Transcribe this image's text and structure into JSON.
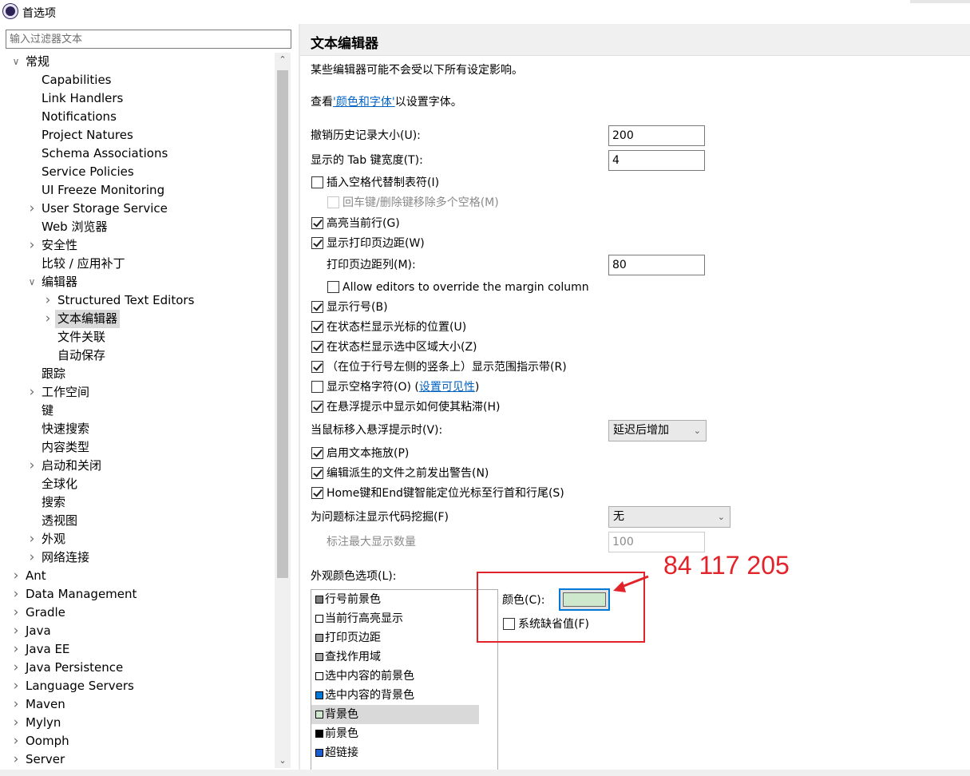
{
  "window": {
    "title": "首选项"
  },
  "filter": {
    "placeholder": "输入过滤器文本"
  },
  "tree": [
    {
      "label": "常规",
      "level": 0,
      "chevron": "expanded"
    },
    {
      "label": "Capabilities",
      "level": 1,
      "chevron": "none"
    },
    {
      "label": "Link Handlers",
      "level": 1,
      "chevron": "none"
    },
    {
      "label": "Notifications",
      "level": 1,
      "chevron": "none"
    },
    {
      "label": "Project Natures",
      "level": 1,
      "chevron": "none"
    },
    {
      "label": "Schema Associations",
      "level": 1,
      "chevron": "none"
    },
    {
      "label": "Service Policies",
      "level": 1,
      "chevron": "none"
    },
    {
      "label": "UI Freeze Monitoring",
      "level": 1,
      "chevron": "none"
    },
    {
      "label": "User Storage Service",
      "level": 1,
      "chevron": "collapsed"
    },
    {
      "label": "Web 浏览器",
      "level": 1,
      "chevron": "none"
    },
    {
      "label": "安全性",
      "level": 1,
      "chevron": "collapsed"
    },
    {
      "label": "比较 / 应用补丁",
      "level": 1,
      "chevron": "none"
    },
    {
      "label": "编辑器",
      "level": 1,
      "chevron": "expanded"
    },
    {
      "label": "Structured Text Editors",
      "level": 2,
      "chevron": "collapsed"
    },
    {
      "label": "文本编辑器",
      "level": 2,
      "chevron": "collapsed",
      "selected": true
    },
    {
      "label": "文件关联",
      "level": 2,
      "chevron": "none"
    },
    {
      "label": "自动保存",
      "level": 2,
      "chevron": "none"
    },
    {
      "label": "跟踪",
      "level": 1,
      "chevron": "none"
    },
    {
      "label": "工作空间",
      "level": 1,
      "chevron": "collapsed"
    },
    {
      "label": "键",
      "level": 1,
      "chevron": "none"
    },
    {
      "label": "快速搜索",
      "level": 1,
      "chevron": "none"
    },
    {
      "label": "内容类型",
      "level": 1,
      "chevron": "none"
    },
    {
      "label": "启动和关闭",
      "level": 1,
      "chevron": "collapsed"
    },
    {
      "label": "全球化",
      "level": 1,
      "chevron": "none"
    },
    {
      "label": "搜索",
      "level": 1,
      "chevron": "none"
    },
    {
      "label": "透视图",
      "level": 1,
      "chevron": "none"
    },
    {
      "label": "外观",
      "level": 1,
      "chevron": "collapsed"
    },
    {
      "label": "网络连接",
      "level": 1,
      "chevron": "collapsed"
    },
    {
      "label": "Ant",
      "level": 0,
      "chevron": "collapsed"
    },
    {
      "label": "Data Management",
      "level": 0,
      "chevron": "collapsed"
    },
    {
      "label": "Gradle",
      "level": 0,
      "chevron": "collapsed"
    },
    {
      "label": "Java",
      "level": 0,
      "chevron": "collapsed"
    },
    {
      "label": "Java EE",
      "level": 0,
      "chevron": "collapsed"
    },
    {
      "label": "Java Persistence",
      "level": 0,
      "chevron": "collapsed"
    },
    {
      "label": "Language Servers",
      "level": 0,
      "chevron": "collapsed"
    },
    {
      "label": "Maven",
      "level": 0,
      "chevron": "collapsed"
    },
    {
      "label": "Mylyn",
      "level": 0,
      "chevron": "collapsed"
    },
    {
      "label": "Oomph",
      "level": 0,
      "chevron": "collapsed"
    },
    {
      "label": "Server",
      "level": 0,
      "chevron": "collapsed"
    }
  ],
  "page": {
    "title": "文本编辑器",
    "note": "某些编辑器可能不会受以下所有设定影响。",
    "font_link_prefix": "查看",
    "font_link": "'颜色和字体'",
    "font_link_suffix": "以设置字体。",
    "undo_label": "撤销历史记录大小(U):",
    "undo_value": "200",
    "tab_label": "显示的 Tab 键宽度(T):",
    "tab_value": "4",
    "insert_spaces": "插入空格代替制表符(I)",
    "backspace_spaces": "回车键/删除键移除多个空格(M)",
    "highlight_line": "高亮当前行(G)",
    "show_margin": "显示打印页边距(W)",
    "margin_col_label": "打印页边距列(M):",
    "margin_col_value": "80",
    "allow_override": "Allow editors to override the margin column",
    "show_line_numbers": "显示行号(B)",
    "status_cursor": "在状态栏显示光标的位置(U)",
    "status_selection": "在状态栏显示选中区域大小(Z)",
    "range_indicator": "（在位于行号左侧的竖条上）显示范围指示带(R)",
    "show_whitespace": "显示空格字符(O) (",
    "whitespace_link": "设置可见性",
    "whitespace_suffix": ")",
    "sticky_hover": "在悬浮提示中显示如何使其粘滞(H)",
    "hover_label": "当鼠标移入悬浮提示时(V):",
    "hover_value": "延迟后增加",
    "drag_drop": "启用文本拖放(P)",
    "warn_derived": "编辑派生的文件之前发出警告(N)",
    "smart_home_end": "Home键和End键智能定位光标至行首和行尾(S)",
    "code_mining_label": "为问题标注显示代码挖掘(F)",
    "code_mining_value": "无",
    "max_annot_label": "标注最大显示数量",
    "max_annot_value": "100",
    "appearance_label": "外观颜色选项(L):",
    "color_label": "颜色(C):",
    "system_default": "系统缺省值(F)",
    "selected_color": "#cde8cc"
  },
  "color_items": [
    {
      "label": "行号前景色",
      "swatch": "#7f7f7f"
    },
    {
      "label": "当前行高亮显示",
      "swatch": "#ffffff"
    },
    {
      "label": "打印页边距",
      "swatch": "#a0a0a0"
    },
    {
      "label": "查找作用域",
      "swatch": "#a8a8a8"
    },
    {
      "label": "选中内容的前景色",
      "swatch": "#ffffff"
    },
    {
      "label": "选中内容的背景色",
      "swatch": "#0078d7"
    },
    {
      "label": "背景色",
      "swatch": "#cde8cc",
      "selected": true
    },
    {
      "label": "前景色",
      "swatch": "#000000"
    },
    {
      "label": "超链接",
      "swatch": "#1a5fd0"
    }
  ],
  "annotation": {
    "text": "84 117 205",
    "color": "#e3232a"
  }
}
